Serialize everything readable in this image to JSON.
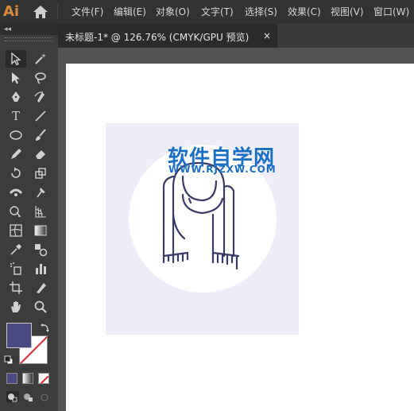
{
  "app": {
    "logo": "Ai"
  },
  "menu": [
    "文件(F)",
    "编辑(E)",
    "对象(O)",
    "文字(T)",
    "选择(S)",
    "效果(C)",
    "视图(V)",
    "窗口(W)"
  ],
  "document_tab": {
    "title": "未标题-1* @ 126.76% (CMYK/GPU 预览)",
    "close": "×"
  },
  "tools": [
    "selection-tool",
    "magic-wand-tool",
    "direct-selection-tool",
    "lasso-tool",
    "pen-tool",
    "curvature-tool",
    "type-tool",
    "line-segment-tool",
    "ellipse-tool",
    "paintbrush-tool",
    "pencil-tool",
    "eraser-tool",
    "rotate-tool",
    "scale-tool",
    "width-tool",
    "puppet-warp-tool",
    "shape-builder-tool",
    "perspective-grid-tool",
    "mesh-tool",
    "gradient-tool",
    "eyedropper-tool",
    "blend-tool",
    "symbol-sprayer-tool",
    "column-graph-tool",
    "artboard-tool",
    "slice-tool",
    "hand-tool",
    "zoom-tool"
  ],
  "type_tool_glyph": "T",
  "colors": {
    "fill": "#4b4a82",
    "stroke": "none",
    "artboard_bg": "#eeeef8",
    "circle": "#ffffff",
    "scarf_stroke": "#3a3a66",
    "accent": "#1a6fc4"
  },
  "watermark": {
    "title": "软件自学网",
    "url": "WWW.RJZXW.COM"
  },
  "panel_collapse": "◂◂"
}
